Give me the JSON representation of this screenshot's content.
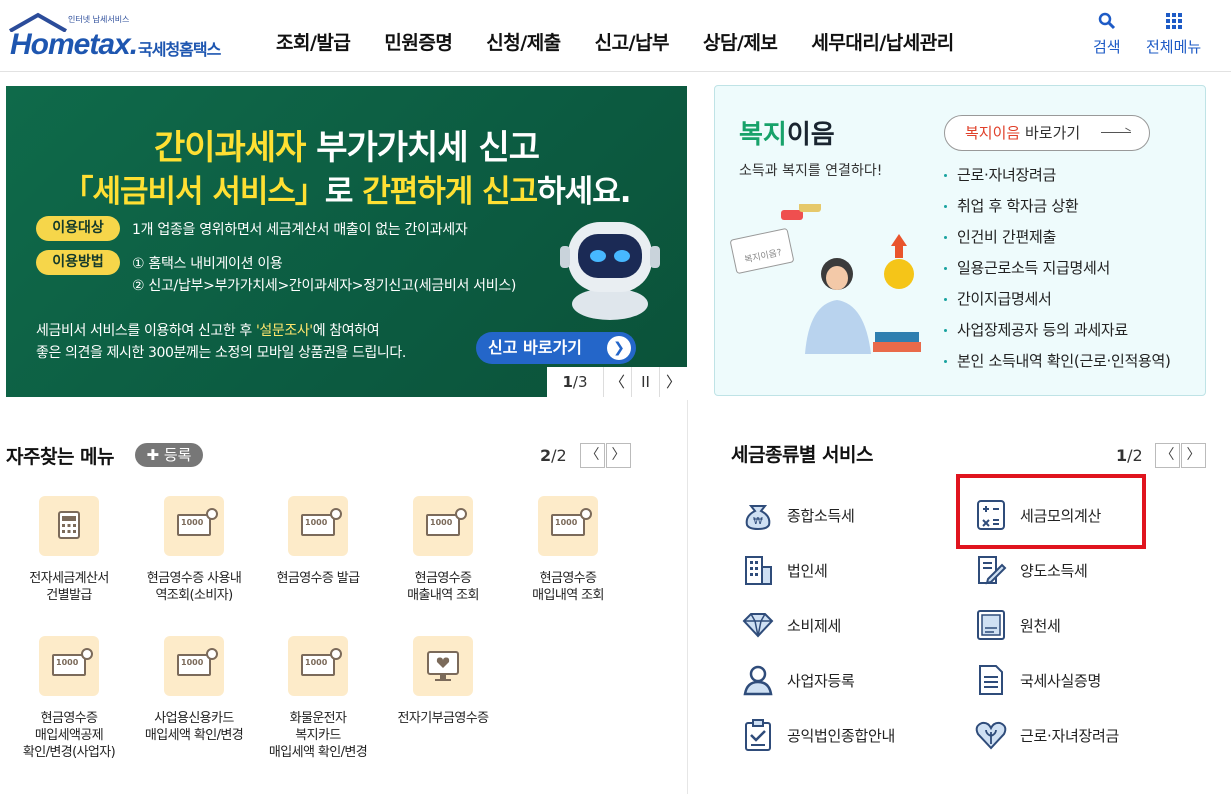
{
  "header": {
    "logo_sub": "인터넷 납세서비스",
    "logo_main": "Hometax.",
    "logo_kr": "국세청홈택스",
    "nav": [
      "조회/발급",
      "민원증명",
      "신청/제출",
      "신고/납부",
      "상담/제보",
      "세무대리/납세관리"
    ],
    "search_label": "검색",
    "menu_label": "전체메뉴"
  },
  "banner": {
    "title1_a": "간이과세자",
    "title1_b": " 부가가치세 신고",
    "title2_a": "「세금비서 서비스」",
    "title2_b": "로 ",
    "title2_c": "간편하게 신고",
    "title2_d": "하세요.",
    "pill1": "이용대상",
    "line1": "1개 업종을 영위하면서 세금계산서 매출이 없는 간이과세자",
    "pill2": "이용방법",
    "line2": "① 홈택스 내비게이션 이용",
    "line3": "② 신고/납부>부가가치세>간이과세자>정기신고(세금비서 서비스)",
    "note1_a": "세금비서 서비스를 이용하여 신고한 후 ",
    "note1_b": "'설문조사'",
    "note1_c": "에 참여하여",
    "note2": "좋은 의견을 제시한 300분께는 소정의 모바일 상품권을 드립니다.",
    "cta": "신고 바로가기",
    "page_current": "1",
    "page_total": "/3",
    "pause": "II",
    "prev": "〈",
    "next": "〉"
  },
  "welfare": {
    "title_a": "복지",
    "title_b": "이음",
    "subtitle": "소득과 복지를 연결하다!",
    "go_a": "복지이음",
    "go_b": " 바로가기",
    "items": [
      "근로·자녀장려금",
      "취업 후 학자금 상환",
      "인건비 간편제출",
      "일용근로소득 지급명세서",
      "간이지급명세서",
      "사업장제공자 등의 과세자료",
      "본인 소득내역 확인(근로·인적용역)"
    ],
    "illust_sign": "복지이음?"
  },
  "frequent": {
    "title": "자주찾는 메뉴",
    "register": "등록",
    "page_current": "2",
    "page_total": "/2",
    "items": [
      {
        "label": "전자세금계산서\n건별발급",
        "icon": "calculator-icon"
      },
      {
        "label": "현금영수증 사용내\n역조회(소비자)",
        "icon": "receipt-search-icon"
      },
      {
        "label": "현금영수증 발급",
        "icon": "receipt-search-icon"
      },
      {
        "label": "현금영수증\n매출내역 조회",
        "icon": "receipt-search-icon"
      },
      {
        "label": "현금영수증\n매입내역 조회",
        "icon": "receipt-search-icon"
      },
      {
        "label": "현금영수증\n매입세액공제\n확인/변경(사업자)",
        "icon": "receipt-search-icon"
      },
      {
        "label": "사업용신용카드\n매입세액 확인/변경",
        "icon": "receipt-search-icon"
      },
      {
        "label": "화물운전자\n복지카드\n매입세액 확인/변경",
        "icon": "receipt-search-icon"
      },
      {
        "label": "전자기부금영수증",
        "icon": "donation-monitor-icon"
      }
    ],
    "receipt_text": "1000"
  },
  "taxservice": {
    "title": "세금종류별 서비스",
    "page_current": "1",
    "page_total": "/2",
    "items": [
      {
        "label": "종합소득세",
        "icon": "money-bag-icon"
      },
      {
        "label": "세금모의계산",
        "icon": "calculator-icon"
      },
      {
        "label": "법인세",
        "icon": "building-icon"
      },
      {
        "label": "양도소득세",
        "icon": "document-pen-icon"
      },
      {
        "label": "소비제세",
        "icon": "diamond-icon"
      },
      {
        "label": "원천세",
        "icon": "receipt-sal-icon"
      },
      {
        "label": "사업자등록",
        "icon": "person-icon"
      },
      {
        "label": "국세사실증명",
        "icon": "certificate-icon"
      },
      {
        "label": "공익법인종합안내",
        "icon": "clipboard-check-icon"
      },
      {
        "label": "근로·자녀장려금",
        "icon": "heart-leaf-icon"
      }
    ]
  },
  "colors": {
    "brand_blue": "#1e56b0",
    "banner_green": "#0f6a4a",
    "banner_yellow": "#ffe033",
    "highlight_red": "#e0141e",
    "welfare_green": "#17a26a"
  }
}
